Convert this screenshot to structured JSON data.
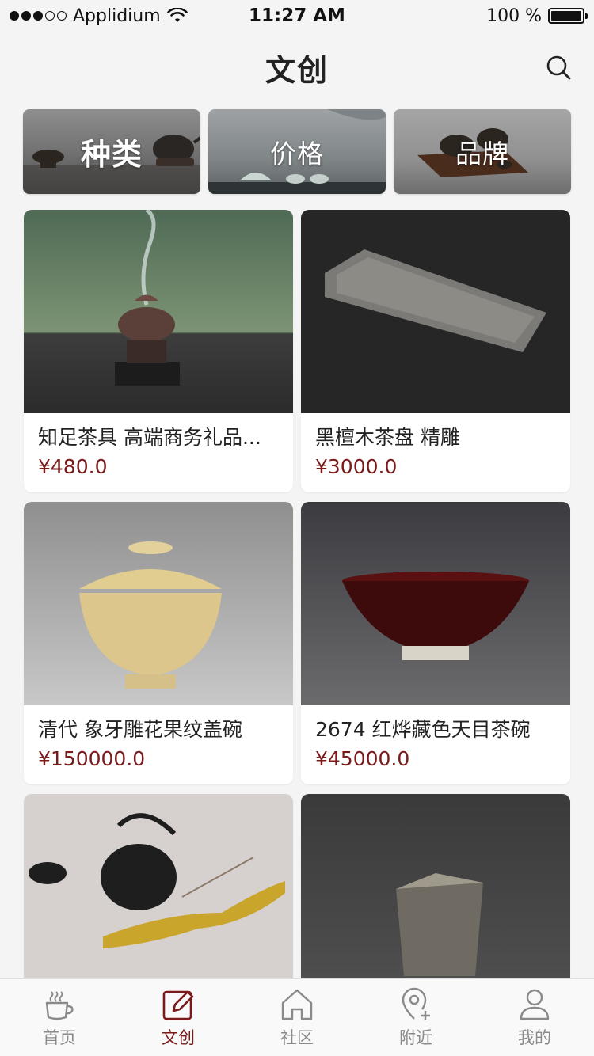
{
  "status_bar": {
    "carrier": "Applidium",
    "time": "11:27 AM",
    "battery": "100 %",
    "battery_level": 1.0,
    "signal_bars": 3,
    "signal_total": 5
  },
  "header": {
    "title": "文创",
    "search_icon": "search-icon"
  },
  "filters": [
    {
      "label": "种类"
    },
    {
      "label": "价格"
    },
    {
      "label": "品牌"
    }
  ],
  "products": [
    {
      "name": "知足茶具 高端商务礼品...",
      "price": "¥480.0"
    },
    {
      "name": "黑檀木茶盘 精雕",
      "price": "¥3000.0"
    },
    {
      "name": "清代 象牙雕花果纹盖碗",
      "price": "¥150000.0"
    },
    {
      "name": "2674 红烨藏色天目茶碗",
      "price": "¥45000.0"
    },
    {
      "name": "",
      "price": ""
    },
    {
      "name": "",
      "price": ""
    }
  ],
  "tabs": [
    {
      "label": "首页",
      "icon": "coffee-cup-icon",
      "active": false
    },
    {
      "label": "文创",
      "icon": "edit-icon",
      "active": true
    },
    {
      "label": "社区",
      "icon": "home-icon",
      "active": false
    },
    {
      "label": "附近",
      "icon": "location-icon",
      "active": false
    },
    {
      "label": "我的",
      "icon": "user-icon",
      "active": false
    }
  ],
  "colors": {
    "accent": "#7a1a1a",
    "inactive": "#8a8a8a",
    "background": "#f4f4f4"
  }
}
